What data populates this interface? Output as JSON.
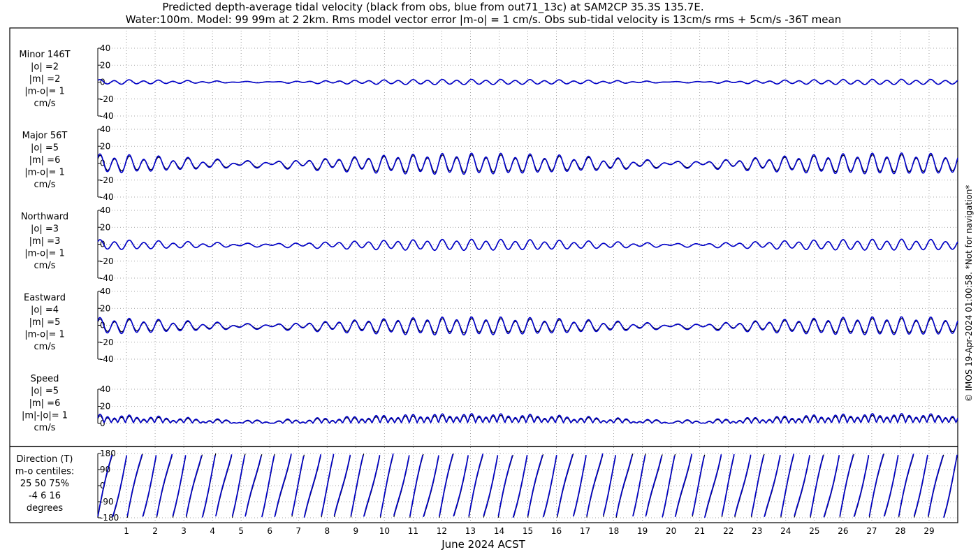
{
  "title": {
    "line1": "Predicted depth-average tidal velocity (black from obs, blue from out71_13c) at SAM2CP 35.3S 135.7E.",
    "line2": "Water:100m. Model: 99 99m at 2 2km. Rms model vector error |m-o| = 1 cm/s. Obs sub-tidal velocity is 13cm/s rms + 5cm/s -36T mean"
  },
  "xlabel": "June 2024 ACST",
  "credit": "© IMOS 19-Apr-2024 01:00:58. *Not for navigation*",
  "x_ticks": [
    "1",
    "2",
    "3",
    "4",
    "5",
    "6",
    "7",
    "8",
    "9",
    "10",
    "11",
    "12",
    "13",
    "14",
    "15",
    "16",
    "17",
    "18",
    "19",
    "20",
    "21",
    "22",
    "23",
    "24",
    "25",
    "26",
    "27",
    "28",
    "29"
  ],
  "colors": {
    "obs": "#000000",
    "model": "#0000cc",
    "grid": "#888888"
  },
  "panels": [
    {
      "label_lines": [
        "Minor 146T",
        "|o| =2",
        "|m| =2",
        "|m-o|= 1",
        "cm/s"
      ],
      "yticks": [
        "40",
        "20",
        "0",
        "-20",
        "-40"
      ]
    },
    {
      "label_lines": [
        "Major 56T",
        "|o| =5",
        "|m| =6",
        "|m-o|= 1",
        "cm/s"
      ],
      "yticks": [
        "40",
        "20",
        "0",
        "-20",
        "-40"
      ]
    },
    {
      "label_lines": [
        "Northward",
        "|o| =3",
        "|m| =3",
        "|m-o|= 1",
        "cm/s"
      ],
      "yticks": [
        "40",
        "20",
        "0",
        "-20",
        "-40"
      ]
    },
    {
      "label_lines": [
        "Eastward",
        "|o| =4",
        "|m| =5",
        "|m-o|= 1",
        "cm/s"
      ],
      "yticks": [
        "40",
        "20",
        "0",
        "-20",
        "-40"
      ]
    },
    {
      "label_lines": [
        "Speed",
        "|o| =5",
        "|m| =6",
        "|m|-|o|= 1",
        "cm/s"
      ],
      "yticks": [
        "40",
        "20",
        "0"
      ]
    },
    {
      "label_lines": [
        "Direction (T)",
        "m-o centiles:",
        "25  50  75%",
        "-4   6  16",
        "degrees"
      ],
      "yticks": [
        "180",
        "90",
        "0",
        "-90",
        "-180"
      ]
    }
  ],
  "chart_data": {
    "type": "line",
    "x_range_days": [
      0,
      30
    ],
    "x_unit": "day of June 2024 (ACST)",
    "series_note_obs": "black",
    "series_note_model": "blue",
    "panels": [
      {
        "name": "Minor 146T",
        "ylim": [
          -40,
          40
        ],
        "obs_rms": 2,
        "model_rms": 2,
        "amp_M2": 1.5,
        "amp_S2": 1.2,
        "amp_K1": 0.6,
        "offset": 0
      },
      {
        "name": "Major 56T",
        "ylim": [
          -40,
          40
        ],
        "obs_rms": 5,
        "model_rms": 6,
        "amp_M2": 5.5,
        "amp_S2": 3.5,
        "amp_K1": 2.0,
        "offset": -1
      },
      {
        "name": "Northward",
        "ylim": [
          -40,
          40
        ],
        "obs_rms": 3,
        "model_rms": 3,
        "amp_M2": 3.5,
        "amp_S2": 2.2,
        "amp_K1": 1.2,
        "offset": -1
      },
      {
        "name": "Eastward",
        "ylim": [
          -40,
          40
        ],
        "obs_rms": 4,
        "model_rms": 5,
        "amp_M2": 4.5,
        "amp_S2": 3.0,
        "amp_K1": 1.5,
        "offset": -1
      },
      {
        "name": "Speed",
        "ylim": [
          0,
          40
        ],
        "obs_rms": 5,
        "model_rms": 6
      },
      {
        "name": "Direction (T)",
        "ylim": [
          -180,
          180
        ],
        "centiles_pct": [
          25,
          50,
          75
        ],
        "centiles_deg": [
          -4,
          6,
          16
        ]
      }
    ]
  }
}
